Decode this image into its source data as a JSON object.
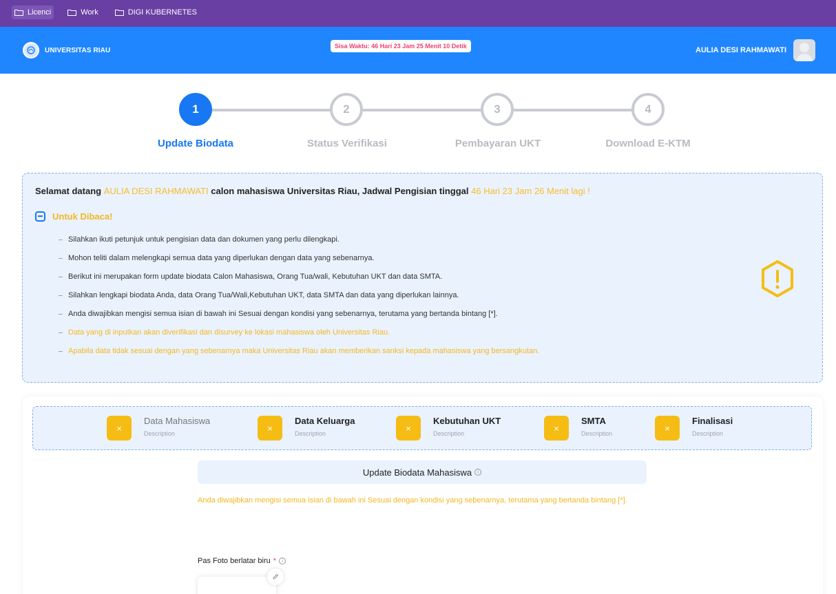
{
  "bookmarks": [
    {
      "label": "Licenci",
      "icon": "folder-icon"
    },
    {
      "label": "Work",
      "icon": "folder-icon"
    },
    {
      "label": "DIGI KUBERNETES",
      "icon": "folder-icon"
    }
  ],
  "header": {
    "brand": "UNIVERSITAS RIAU",
    "countdown": "Sisa Waktu: 46 Hari 23 Jam 25 Menit 10 Detik",
    "user_name": "AULIA DESI RAHMAWATI"
  },
  "stepper": {
    "steps": [
      {
        "number": "1",
        "label": "Update Biodata"
      },
      {
        "number": "2",
        "label": "Status Verifikasi"
      },
      {
        "number": "3",
        "label": "Pembayaran UKT"
      },
      {
        "number": "4",
        "label": "Download E-KTM"
      }
    ],
    "active_step": 1
  },
  "notice": {
    "welcome_prefix": "Selamat datang",
    "welcome_name": "AULIA DESI RAHMAWATI",
    "welcome_middle": "calon mahasiswa Universitas Riau, Jadwal Pengisian tinggal",
    "welcome_time": "46 Hari 23 Jam 26 Menit lagi !",
    "read_title": "Untuk Dibaca!",
    "items": [
      "Silahkan ikuti petunjuk untuk pengisian data dan dokumen yang perlu dilengkapi.",
      "Mohon teliti dalam melengkapi semua data yang diperlukan dengan data yang sebenarnya.",
      "Berikut ini merupakan form update biodata Calon Mahasiswa, Orang Tua/wali, Kebutuhan UKT dan data SMTA.",
      "Silahkan lengkapi biodata Anda, data Orang Tua/Wali,Kebutuhan UKT, data SMTA dan data yang diperlukan lainnya.",
      "Anda diwajibkan mengisi semua isian di bawah ini Sesuai dengan kondisi yang sebenarnya, terutama yang bertanda bintang [*].",
      "Data yang di inputkan akan diverifikasi dan disurvey ke lokasi mahasiswa oleh Universitas Riau.",
      "Apabila data tidak sesuai dengan yang sebenarnya maka Universitas Riau akan memberikan sanksi kepada mahasiswa yang bersangkutan."
    ]
  },
  "form_tabs": [
    {
      "title": "Data Mahasiswa",
      "desc": "Description",
      "mark": "×"
    },
    {
      "title": "Data Keluarga",
      "desc": "Description",
      "mark": "×"
    },
    {
      "title": "Kebutuhan UKT",
      "desc": "Description",
      "mark": "×"
    },
    {
      "title": "SMTA",
      "desc": "Description",
      "mark": "×"
    },
    {
      "title": "Finalisasi",
      "desc": "Description",
      "mark": "×"
    }
  ],
  "form": {
    "section_title": "Update Biodata Mahasiswa",
    "warning": "Anda diwajibkan mengisi semua isian di bawah ini Sesuai dengan kondisi yang sebenarnya, terutama yang bertanda bintang [*].",
    "photo_label": "Pas Foto berlatar biru",
    "required_mark": "*",
    "info_glyph": "i"
  },
  "colors": {
    "bookmark_bar": "#6a3fa3",
    "topbar": "#1f86ff",
    "primary": "#1877f2",
    "warning": "#f3b820",
    "danger": "#f03e6e"
  }
}
